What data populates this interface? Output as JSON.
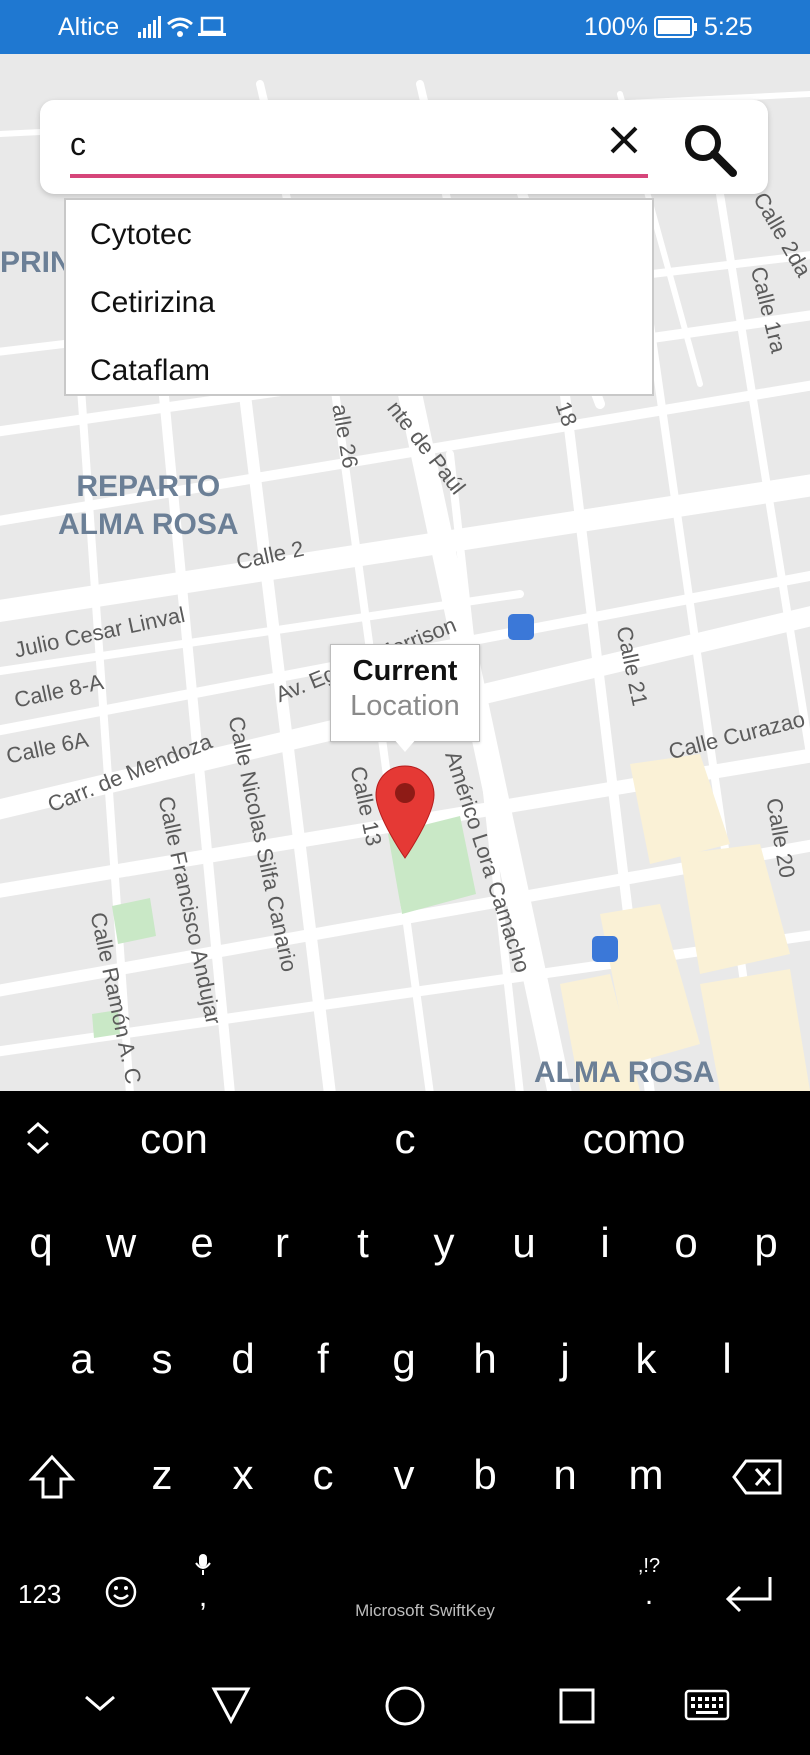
{
  "status_bar": {
    "carrier": "Altice",
    "battery": "100%",
    "time": "5:25"
  },
  "search": {
    "value": "c"
  },
  "suggestions": [
    "Cytotec",
    "Cetirizina",
    "Cataflam"
  ],
  "map": {
    "areas": [
      "REPARTO",
      "ALMA ROSA",
      "ALMA ROSA",
      "PRIN"
    ],
    "streets": {
      "calle2": "Calle 2",
      "julio": "Julio Cesar Linval",
      "calle8a": "Calle 8-A",
      "calle6a": "Calle 6A",
      "carr": "Carr. de Mendoza",
      "avmorrison": "Av. Egbert Morrison",
      "nicolas": "Calle Nicolas Silfa Canario",
      "francisco": "Calle Francisco Andujar",
      "ramon": "Calle Ramón A. C",
      "calle13": "Calle 13",
      "americo": "Américo Lora Camacho",
      "calle21": "Calle 21",
      "curazao": "Calle Curazao",
      "calle20": "Calle 20",
      "calle1ra": "Calle 1ra",
      "calle2da": "Calle 2da",
      "calle26": "alle 26",
      "vicente": "nte de Paúl",
      "calle18": "18"
    },
    "callout": {
      "title": "Current",
      "subtitle": "Location"
    }
  },
  "keyboard": {
    "suggestions": [
      "con",
      "c",
      "como"
    ],
    "row1": [
      "q",
      "w",
      "e",
      "r",
      "t",
      "y",
      "u",
      "i",
      "o",
      "p"
    ],
    "row2": [
      "a",
      "s",
      "d",
      "f",
      "g",
      "h",
      "j",
      "k",
      "l"
    ],
    "row3": [
      "z",
      "x",
      "c",
      "v",
      "b",
      "n",
      "m"
    ],
    "numbers_key": "123",
    "comma": ",",
    "period": ".",
    "punct": ",!?",
    "spacebar": "Microsoft SwiftKey"
  },
  "colors": {
    "status_bar": "#1f78d1",
    "underline": "#d6457a",
    "pin": "#e53935",
    "keyboard_bg": "#000000"
  }
}
